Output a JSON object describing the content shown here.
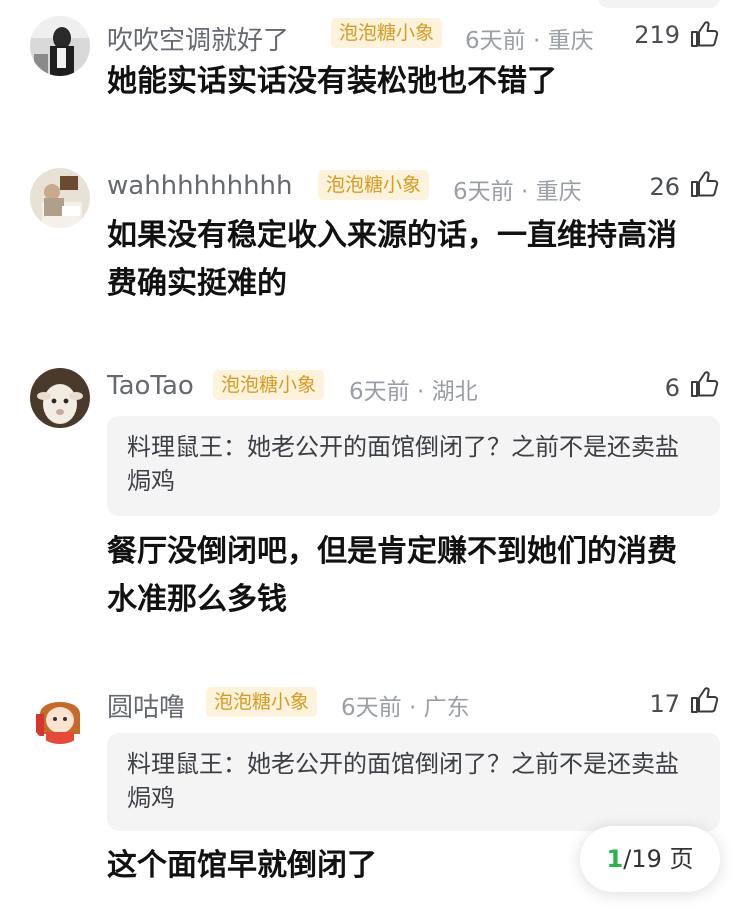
{
  "comments": [
    {
      "name": "吹吹空调就好了",
      "badge": "泡泡糖小象",
      "meta": "6天前 · 重庆",
      "likes": "219",
      "text": "她能实话实话没有装松弛也不错了"
    },
    {
      "name": "wahhhhhhhhh",
      "badge": "泡泡糖小象",
      "meta": "6天前 · 重庆",
      "likes": "26",
      "text": "如果没有稳定收入来源的话，一直维持高消费确实挺难的"
    },
    {
      "name": "TaoTao",
      "badge": "泡泡糖小象",
      "meta": "6天前 · 湖北",
      "likes": "6",
      "quote": "料理鼠王：她老公开的面馆倒闭了？之前不是还卖盐焗鸡",
      "text": "餐厅没倒闭吧，但是肯定赚不到她们的消费水准那么多钱"
    },
    {
      "name": "圆咕噜",
      "badge": "泡泡糖小象",
      "meta": "6天前 · 广东",
      "likes": "17",
      "quote": "料理鼠王：她老公开的面馆倒闭了？之前不是还卖盐焗鸡",
      "text": "这个面馆早就倒闭了"
    }
  ],
  "pager": {
    "current": "1",
    "total": "/19 页"
  },
  "colors": {
    "badge_bg": "#fdf3dc",
    "badge_text": "#d79b23",
    "page_current": "#2bb24c"
  },
  "icons": {
    "like": "thumbs-up-icon"
  }
}
